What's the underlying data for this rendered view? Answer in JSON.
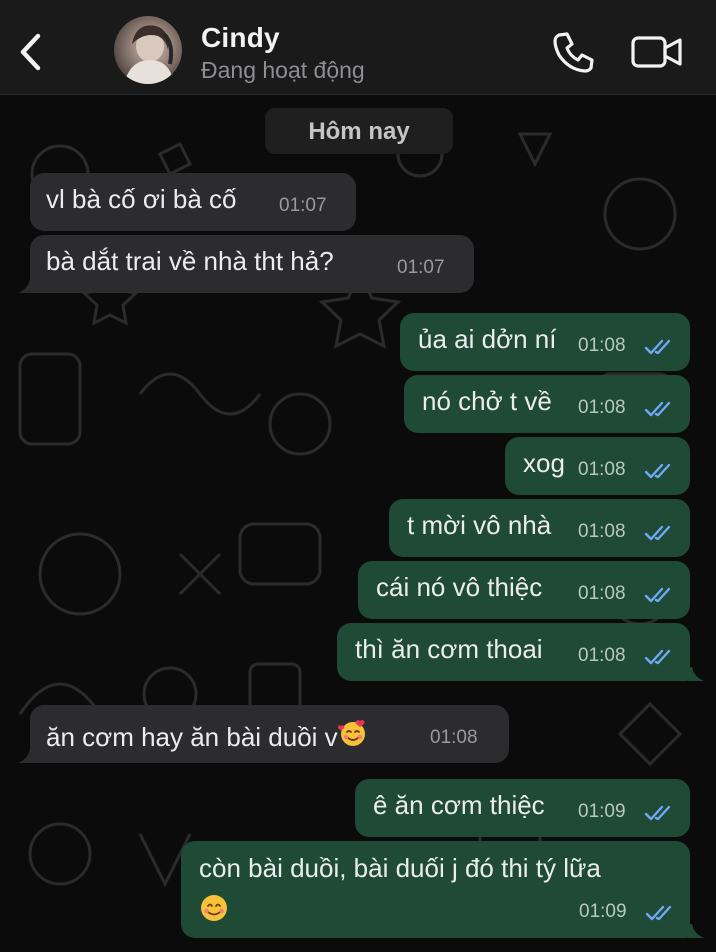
{
  "header": {
    "contact_name": "Cindy",
    "status": "Đang hoạt động",
    "back_icon": "chevron-left-icon",
    "call_icon": "phone-icon",
    "video_icon": "video-camera-icon"
  },
  "date_separator": "Hôm nay",
  "colors": {
    "incoming_bubble": "#2c2c2e",
    "outgoing_bubble": "#1f4a35",
    "read_ticks": "#6fa8f5",
    "background": "#0b0b0b"
  },
  "messages": [
    {
      "direction": "in",
      "text": "vl bà cố ơi bà cố",
      "time": "01:07"
    },
    {
      "direction": "in",
      "text": "bà dắt trai về nhà tht hả?",
      "time": "01:07"
    },
    {
      "direction": "out",
      "text": "ủa ai dởn ní",
      "time": "01:08",
      "status": "read"
    },
    {
      "direction": "out",
      "text": "nó chở t về",
      "time": "01:08",
      "status": "read"
    },
    {
      "direction": "out",
      "text": "xog",
      "time": "01:08",
      "status": "read"
    },
    {
      "direction": "out",
      "text": "t mời vô nhà",
      "time": "01:08",
      "status": "read"
    },
    {
      "direction": "out",
      "text": "cái nó vô thiệc",
      "time": "01:08",
      "status": "read"
    },
    {
      "direction": "out",
      "text": "thì ăn cơm thoai",
      "time": "01:08",
      "status": "read"
    },
    {
      "direction": "in",
      "text": "ăn cơm hay ăn bài duồi v",
      "emoji": "smiling-face-with-hearts-emoji",
      "time": "01:08"
    },
    {
      "direction": "out",
      "text": "ê ăn cơm thiệc",
      "time": "01:09",
      "status": "read"
    },
    {
      "direction": "out",
      "text": "còn bài duồi, bài duối j đó thi tý lữa",
      "emoji": "smiling-face-emoji",
      "time": "01:09",
      "status": "read"
    }
  ]
}
